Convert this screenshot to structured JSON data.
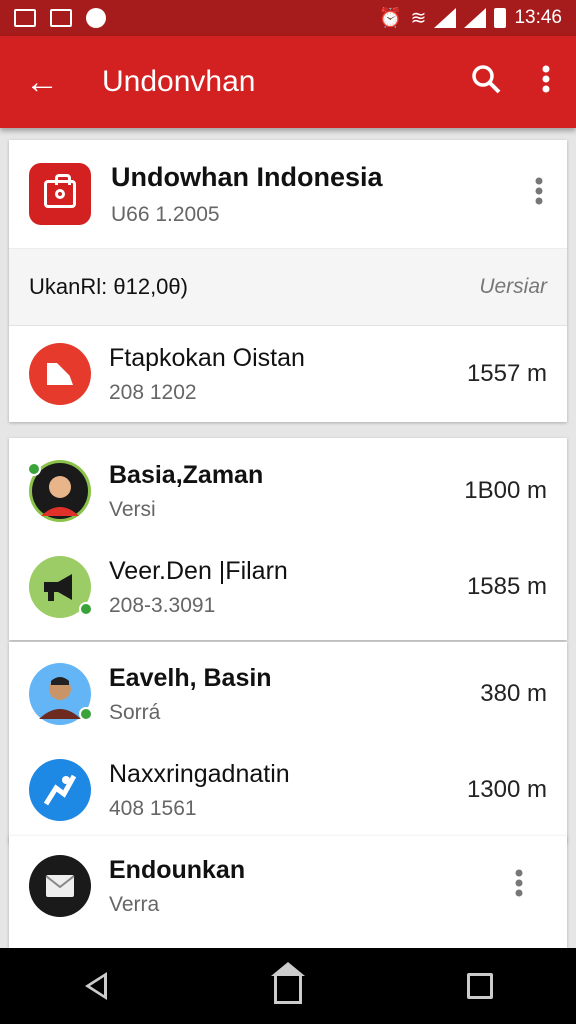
{
  "status_bar": {
    "time": "13:46"
  },
  "app_bar": {
    "title": "Undonvhan"
  },
  "header_card": {
    "title": "Undowhan Indonesia",
    "subtitle": "U66 1.2005",
    "info_label": "UkanRl: θ12,0θ)",
    "info_version": "Uersiar",
    "row": {
      "name": "Ftapkokan Oistan",
      "sub": "208 1202",
      "value": "1557 m"
    }
  },
  "card2": [
    {
      "name": "Basia,Zaman",
      "sub": "Versi",
      "value": "1B00 m"
    },
    {
      "name": "Veer.Den |Filarn",
      "sub": "208-3.3091",
      "value": "1585 m"
    }
  ],
  "card3": [
    {
      "name": "Eavelh, Basin",
      "sub": "Sorrá",
      "value": "380 m"
    },
    {
      "name": "Naxxringadnatin",
      "sub": "408 1561",
      "value": "1300 m"
    }
  ],
  "card4": {
    "name": "Endounkan",
    "sub": "Verra"
  },
  "colors": {
    "status_bar": "#a61b1b",
    "app_bar": "#d32020",
    "accent_blue": "#1e88e5",
    "accent_green": "#8bc34a"
  }
}
